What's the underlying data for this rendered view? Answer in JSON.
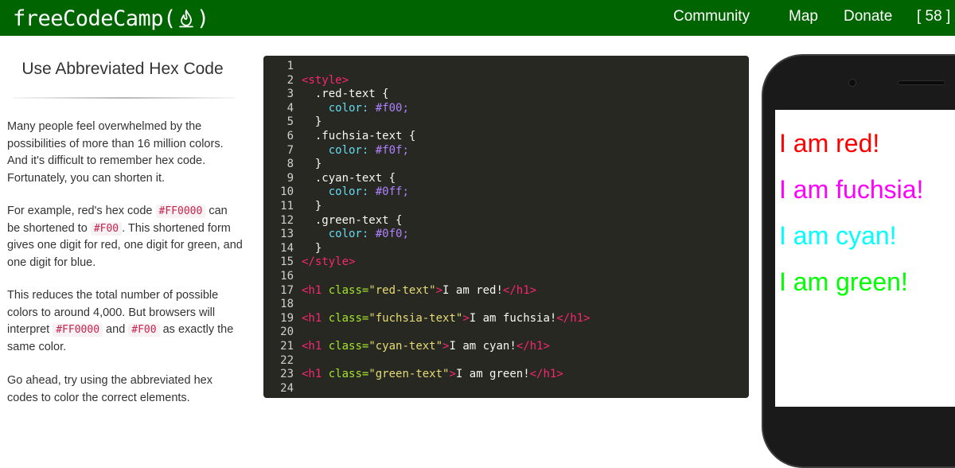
{
  "navbar": {
    "brand_left": "freeCodeCamp(",
    "brand_right": ")",
    "links": {
      "community": "Community",
      "map": "Map",
      "donate": "Donate",
      "points": "[ 58 ]"
    },
    "colors": {
      "bg": "#006400",
      "fg": "#ffffff"
    }
  },
  "lesson": {
    "title": "Use Abbreviated Hex Code",
    "p1": "Many people feel overwhelmed by the possibilities of more than 16 million colors. And it's difficult to remember hex code. Fortunately, you can shorten it.",
    "p2": {
      "a": "For example, red's hex code ",
      "code1": "#FF0000",
      "b": " can be shortened to ",
      "code2": "#F00",
      "c": ". This shortened form gives one digit for red, one digit for green, and one digit for blue."
    },
    "p3": {
      "a": "This reduces the total number of possible colors to around 4,000. But browsers will interpret ",
      "code1": "#FF0000",
      "b": " and ",
      "code2": "#F00",
      "c": " as exactly the same color."
    },
    "p4": "Go ahead, try using the abbreviated hex codes to color the correct elements."
  },
  "editor": {
    "line_numbers": [
      "1",
      "2",
      "3",
      "4",
      "5",
      "6",
      "7",
      "8",
      "9",
      "10",
      "11",
      "12",
      "13",
      "14",
      "15",
      "16",
      "17",
      "18",
      "19",
      "20",
      "21",
      "22",
      "23",
      "24"
    ],
    "style_open": "<style>",
    "style_close": "</style>",
    "rules": [
      {
        "selector": ".red-text",
        "value": "#f00;"
      },
      {
        "selector": ".fuchsia-text",
        "value": "#f0f;"
      },
      {
        "selector": ".cyan-text",
        "value": "#0ff;"
      },
      {
        "selector": ".green-text",
        "value": "#0f0;"
      }
    ],
    "brace_open": " {",
    "brace_close": "}",
    "prop": "color:",
    "h1_open": "<h1",
    "h1_close": "</h1>",
    "attr_name": "class=",
    "tag_gt": ">",
    "headings": [
      {
        "cls": "\"red-text\"",
        "text": "I am red!"
      },
      {
        "cls": "\"fuchsia-text\"",
        "text": "I am fuchsia!"
      },
      {
        "cls": "\"cyan-text\"",
        "text": "I am cyan!"
      },
      {
        "cls": "\"green-text\"",
        "text": "I am green!"
      }
    ],
    "colors": {
      "bg": "#272822",
      "tag": "#f92672",
      "selector": "#a6e22e",
      "property": "#66d9ef",
      "value": "#ae81ff",
      "string": "#e6db74",
      "text": "#f8f8f2"
    }
  },
  "preview": {
    "lines": [
      {
        "text": "I am red!",
        "color": "#ff0000"
      },
      {
        "text": "I am fuchsia!",
        "color": "#ff00ff"
      },
      {
        "text": "I am cyan!",
        "color": "#00ffff"
      },
      {
        "text": "I am green!",
        "color": "#00ff00"
      }
    ],
    "frame_icon": "smartphone-frame"
  }
}
